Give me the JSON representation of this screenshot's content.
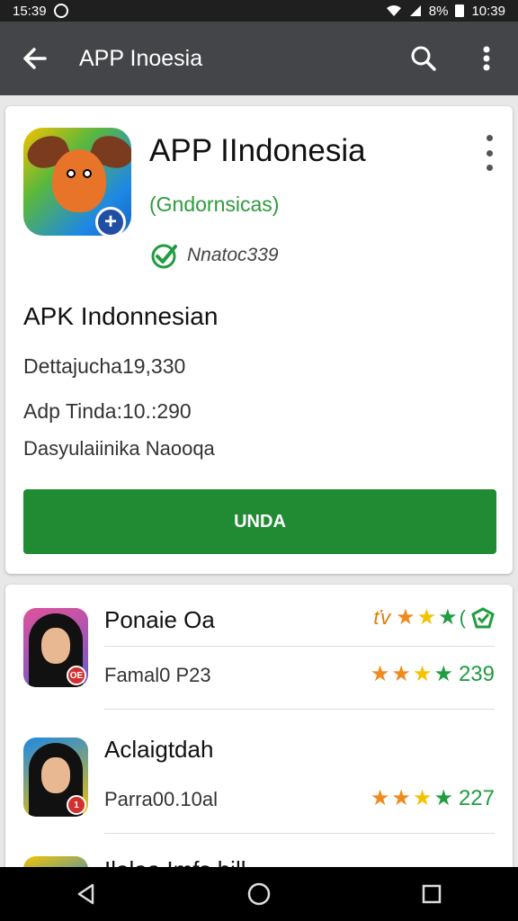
{
  "status_bar": {
    "time_left": "15:39",
    "battery_pct": "8%",
    "time_right": "10:39"
  },
  "app_bar": {
    "title": "APP  Inoesia"
  },
  "app_header": {
    "name": "APP IIndonesia",
    "developer": "(Gndornsicas)",
    "verified_text": "Nnatoc339",
    "subtitle": "APK Indonnesian",
    "info_1": "Dettajucha19,330",
    "info_2": "Adp Tinda:10.:290",
    "info_3": "Dasyulaiinika Naooqa",
    "install_label": "UNDA"
  },
  "list": {
    "items": [
      {
        "name": "Ponaie Oa",
        "top_prefix": "ťv",
        "top_suffix": "(",
        "meta": "Famal0 P23",
        "rating_count": "239",
        "badge": "OE"
      },
      {
        "name": "Aclaigtdah",
        "meta": "Parra00.10al",
        "rating_count": "227",
        "badge": "1"
      },
      {
        "name": "Ilalaa  Imfs  bill"
      }
    ]
  },
  "colors": {
    "accent_green": "#208b32",
    "toolbar": "#444549"
  }
}
